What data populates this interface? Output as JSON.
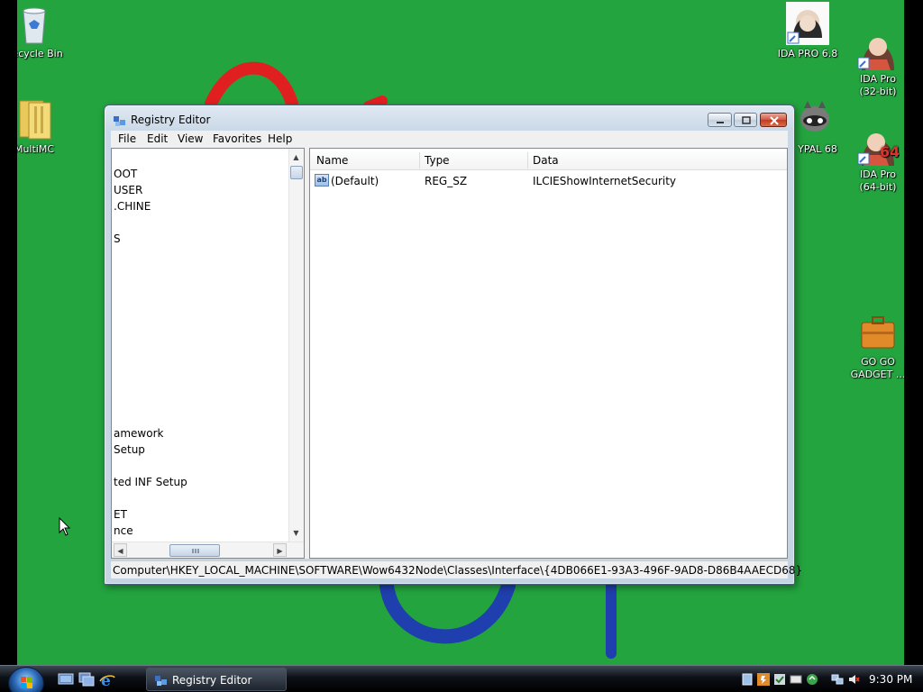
{
  "desktop": {
    "icons": [
      {
        "label": "Recycle Bin"
      },
      {
        "label": "MultiMC"
      },
      {
        "label": "IDA PRO 6.8"
      },
      {
        "label": "IDA Pro\n(32-bit)"
      },
      {
        "label": "YPAL 68"
      },
      {
        "label": "IDA Pro\n(64-bit)"
      },
      {
        "label": "GO GO\nGADGET ..."
      }
    ]
  },
  "window": {
    "title": "Registry Editor",
    "menu": [
      "File",
      "Edit",
      "View",
      "Favorites",
      "Help"
    ],
    "tree": [
      "OOT",
      "USER",
      ".CHINE",
      "S",
      "amework",
      "Setup",
      "ted INF Setup",
      "ET",
      "nce"
    ],
    "list": {
      "columns": [
        "Name",
        "Type",
        "Data"
      ],
      "rows": [
        {
          "name": "(Default)",
          "type": "REG_SZ",
          "data": "ILCIEShowInternetSecurity",
          "icon": "reg-sz-icon"
        }
      ]
    },
    "status": "Computer\\HKEY_LOCAL_MACHINE\\SOFTWARE\\Wow6432Node\\Classes\\Interface\\{4DB066E1-93A3-496F-9AD8-D86B4AAECD68}"
  },
  "taskbar": {
    "task_label": "Registry Editor",
    "clock": "9:30 PM"
  },
  "colors": {
    "desktop": "#23a43f",
    "scribble_red": "#e02020",
    "scribble_blue": "#1f3fae"
  }
}
